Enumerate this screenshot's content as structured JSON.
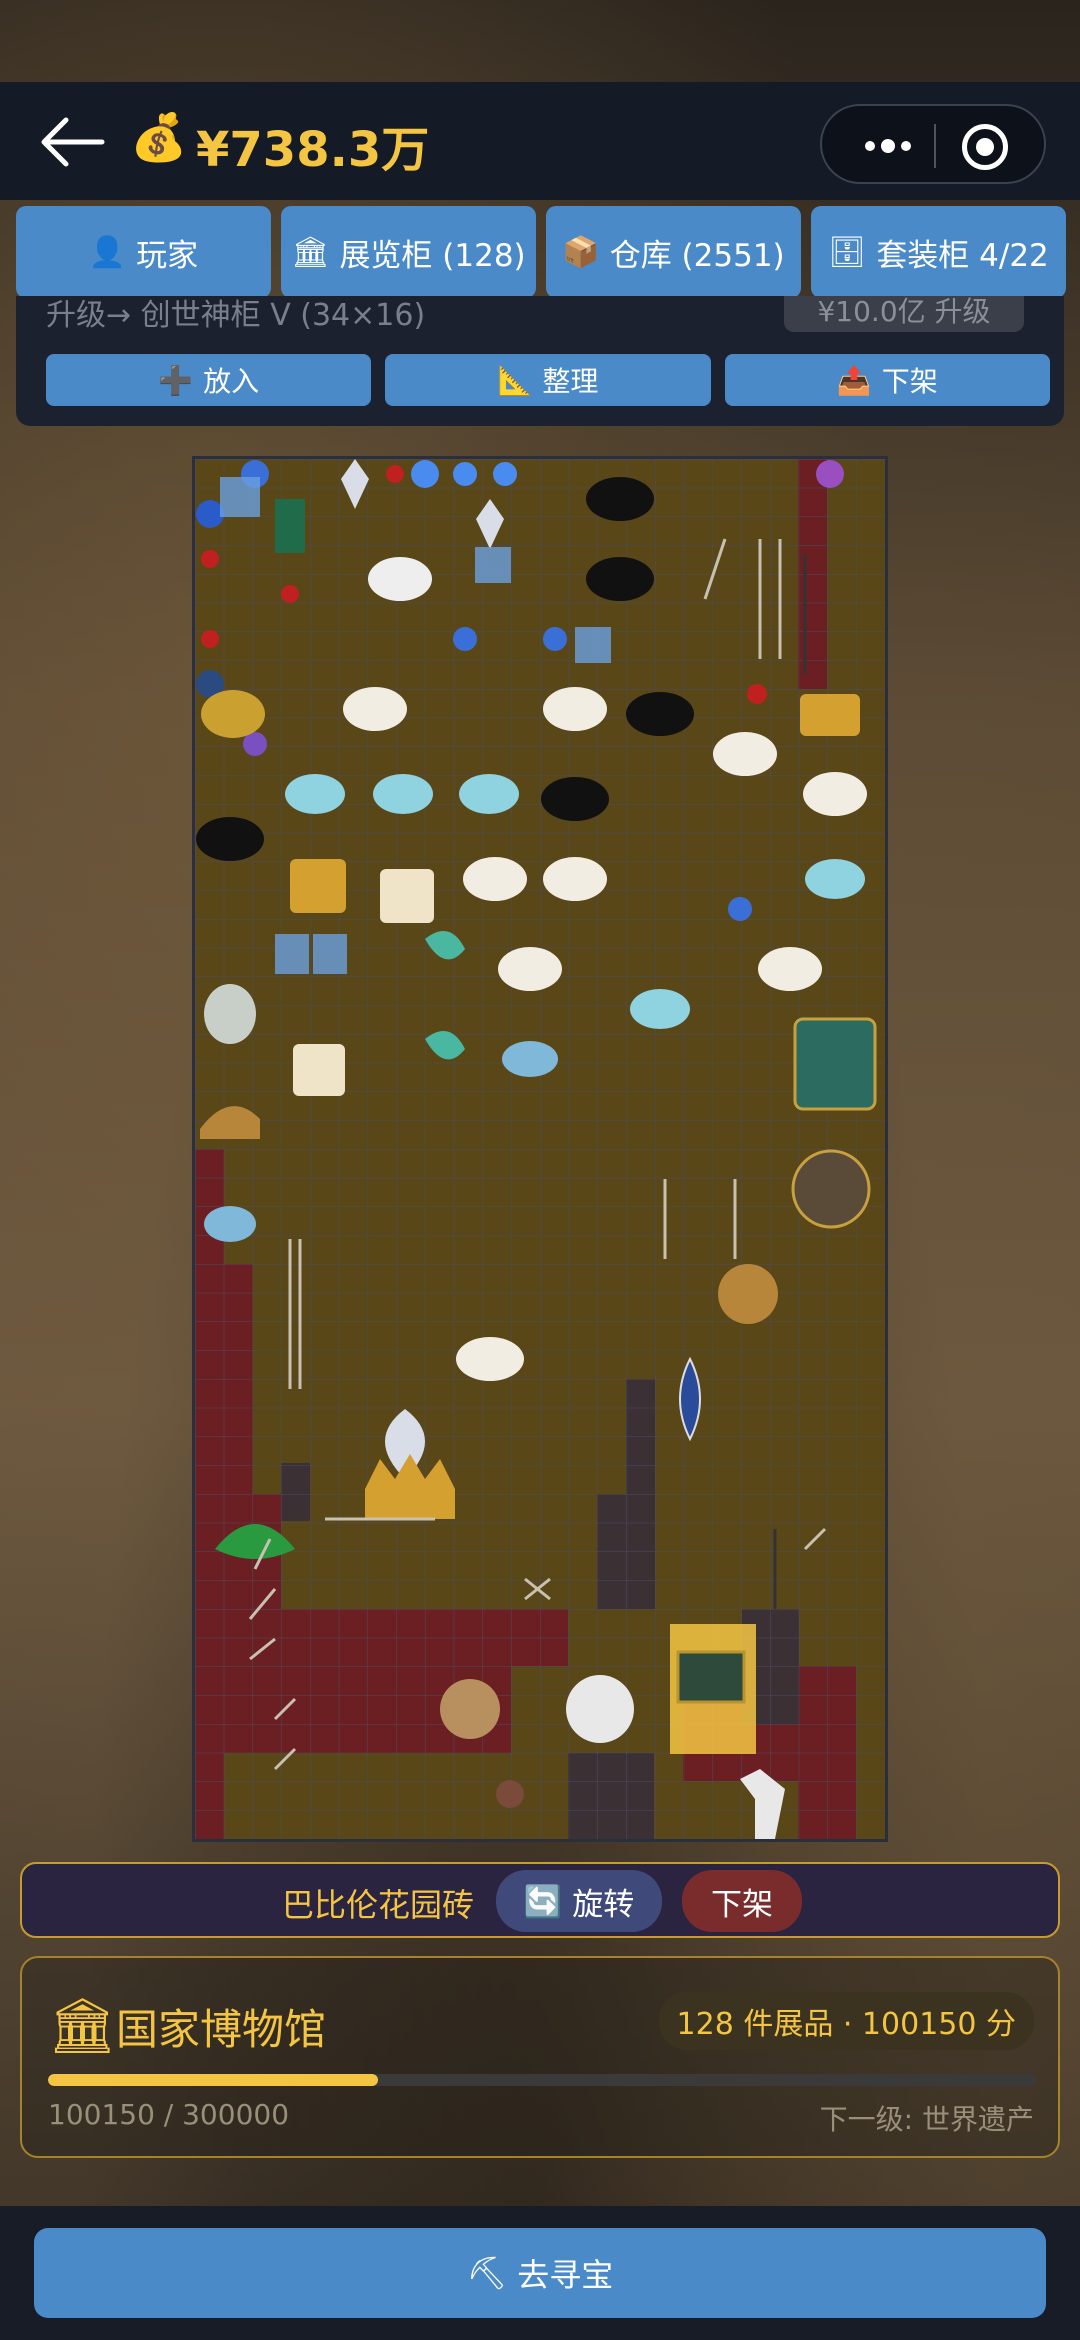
{
  "header": {
    "money": "¥738.3万",
    "money_icon": "money-bag-icon"
  },
  "tabs": [
    {
      "label": "玩家",
      "icon": "user-icon"
    },
    {
      "label": "展览柜 (128)",
      "icon": "museum-icon"
    },
    {
      "label": "仓库 (2551)",
      "icon": "box-icon"
    },
    {
      "label": "套装柜 4/22",
      "icon": "cabinet-icon"
    }
  ],
  "upgrade": {
    "text": "升级→ 创世神柜 V (34×16)",
    "button": "¥10.0亿 升级"
  },
  "actions": {
    "put_in": "放入",
    "organize": "整理",
    "remove": "下架"
  },
  "selection": {
    "name": "巴比伦花园砖",
    "rotate": "旋转",
    "remove": "下架"
  },
  "museum": {
    "name": "国家博物馆",
    "badge": "128 件展品 · 100150 分",
    "progress_text": "100150 / 300000",
    "progress_fraction": 0.3338,
    "next_level": "下一级: 世界遗产"
  },
  "bottom": {
    "hunt": "去寻宝"
  },
  "colors": {
    "accent": "#4a8ac8",
    "gold": "#f4c543",
    "grid_bg": "#5a4718",
    "occupied": "#6b1f22"
  }
}
